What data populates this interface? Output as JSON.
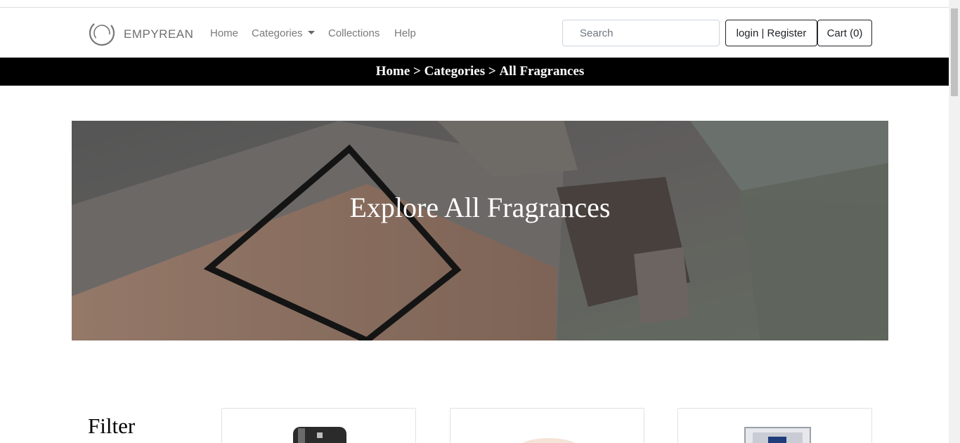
{
  "brand": {
    "name": "EMPYREAN",
    "logo_icon": "circle-swirl-logo"
  },
  "nav": {
    "items": [
      {
        "label": "Home"
      },
      {
        "label": "Categories",
        "has_dropdown": true
      },
      {
        "label": "Collections"
      },
      {
        "label": "Help"
      }
    ]
  },
  "search": {
    "placeholder": "Search",
    "value": ""
  },
  "account": {
    "label": "login | Register"
  },
  "cart": {
    "label": "Cart (0)",
    "count": 0
  },
  "breadcrumb": {
    "items": [
      "Home",
      "Categories",
      "All Fragrances"
    ],
    "separator": ">"
  },
  "hero": {
    "title": "Explore All Fragrances"
  },
  "filter": {
    "title": "Filter"
  },
  "products": [
    {
      "image": "perfume-bottle-black-cap"
    },
    {
      "image": "perfume-bottle-peach"
    },
    {
      "image": "perfume-bottle-blue-box"
    }
  ],
  "colors": {
    "breadcrumb_bg": "#000000",
    "text": "#212529",
    "nav_link": "#7a7a7a"
  }
}
